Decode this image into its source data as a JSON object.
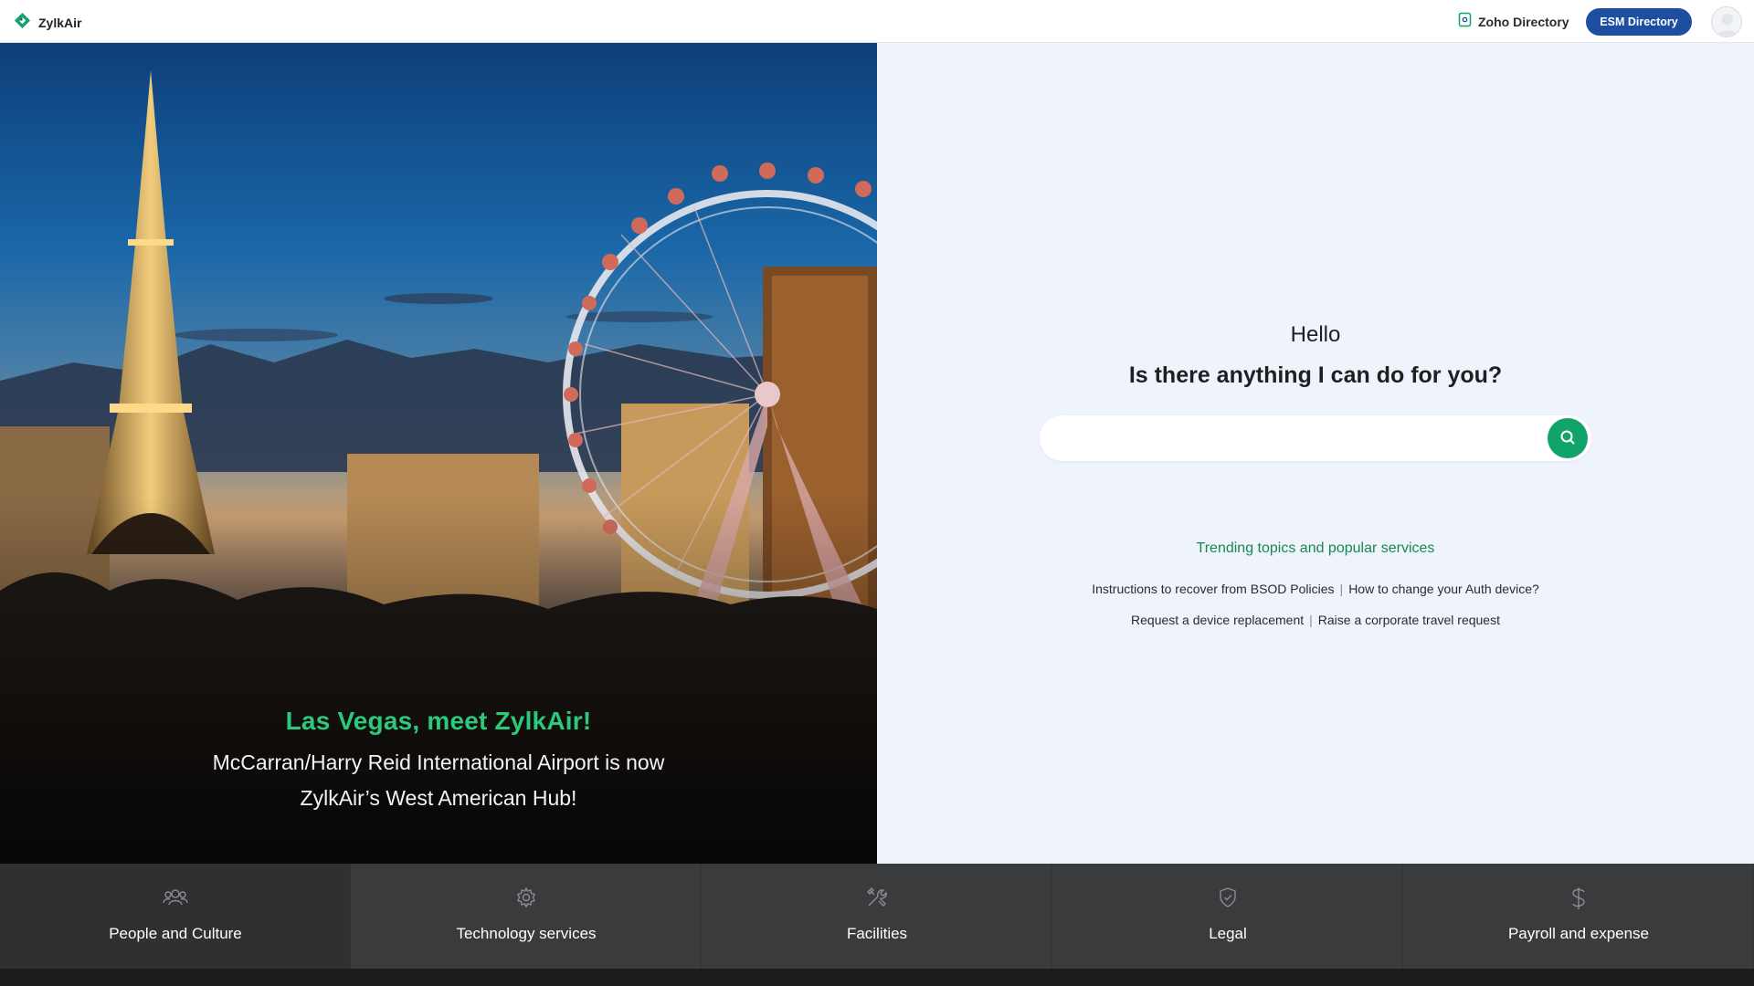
{
  "header": {
    "brand_name": "ZylkAir",
    "brand_icon": "zylkair-logo-icon",
    "directory_link": "Zoho Directory",
    "directory_icon": "directory-icon",
    "esm_button": "ESM Directory",
    "avatar_icon": "user-avatar-icon",
    "colors": {
      "esm_button_bg": "#1e4ea0",
      "brand_icon": "#10a36a"
    }
  },
  "hero": {
    "title": "Las Vegas, meet ZylkAir!",
    "subtitle_line1": "McCarran/Harry Reid International Airport is now",
    "subtitle_line2": "ZylkAir’s West American Hub!",
    "colors": {
      "title": "#2cc97a"
    }
  },
  "search": {
    "greeting": "Hello",
    "question": "Is there anything I can do for you?",
    "input_value": "",
    "placeholder": "",
    "button_icon": "search-icon",
    "trending_heading": "Trending topics and popular services",
    "links": [
      "Instructions to recover from BSOD Policies",
      "How to change your Auth device?",
      "Request a device replacement",
      "Raise a corporate travel request"
    ],
    "colors": {
      "button_bg": "#10a36a",
      "trending": "#168a4f",
      "panel_bg": "#eff3fb"
    }
  },
  "categories": [
    {
      "label": "People and Culture",
      "icon": "people-icon"
    },
    {
      "label": "Technology services",
      "icon": "gear-icon"
    },
    {
      "label": "Facilities",
      "icon": "tools-icon"
    },
    {
      "label": "Legal",
      "icon": "shield-check-icon"
    },
    {
      "label": "Payroll and expense",
      "icon": "dollar-icon"
    }
  ]
}
